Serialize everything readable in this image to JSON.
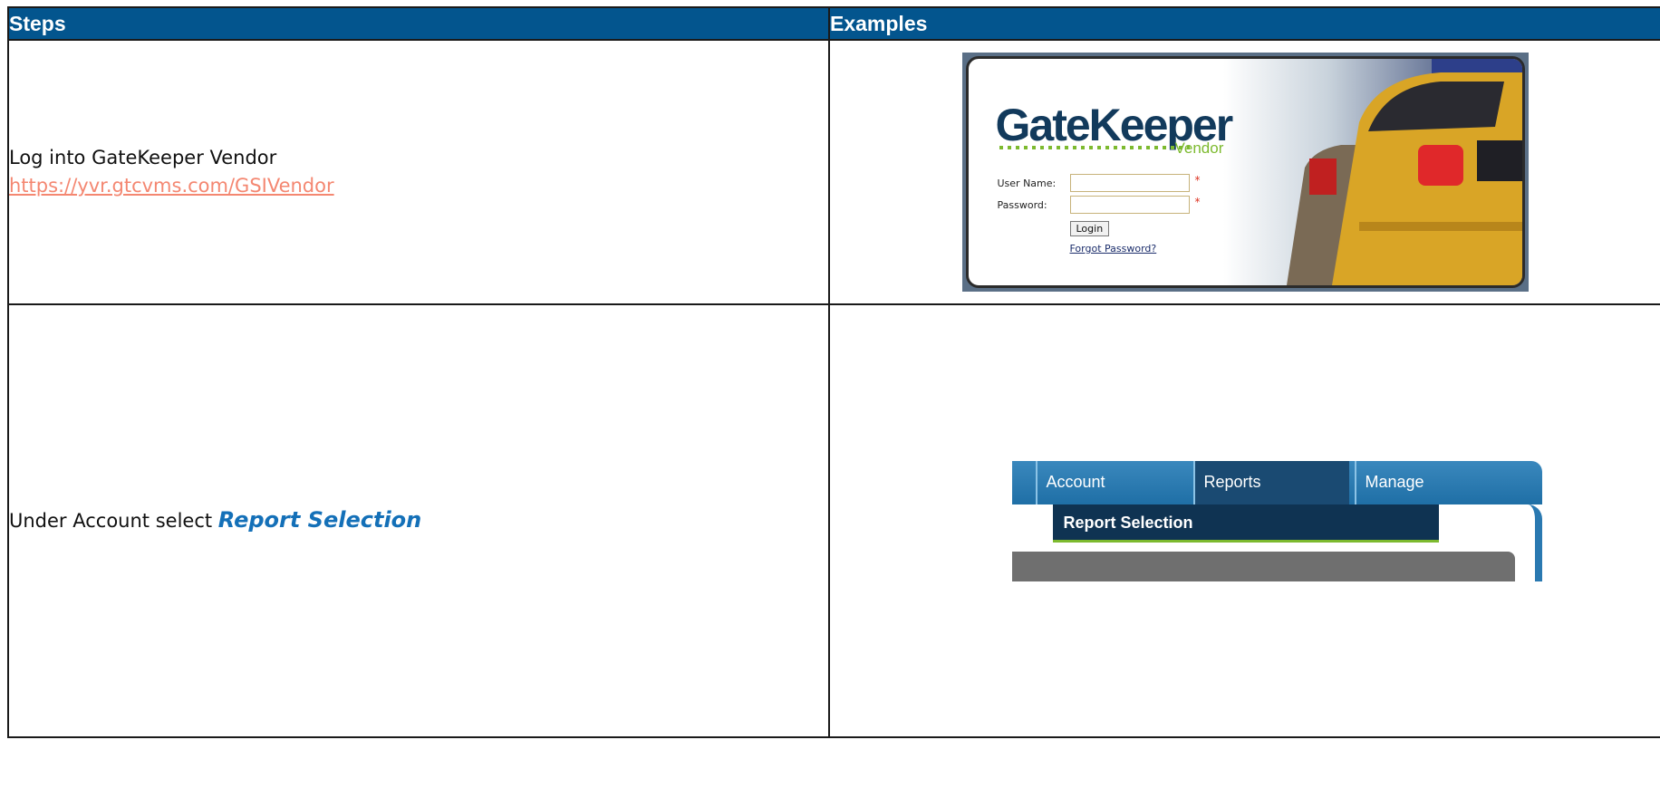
{
  "table": {
    "headers": {
      "steps": "Steps",
      "examples": "Examples"
    },
    "rows": [
      {
        "step_text": "Log into GateKeeper Vendor",
        "step_link": "https://yvr.gtcvms.com/GSIVendor",
        "example": {
          "logo_text": "GateKeeper",
          "logo_sub": "Vendor",
          "username_label": "User Name:",
          "password_label": "Password:",
          "required_mark": "*",
          "login_button": "Login",
          "forgot_link": "Forgot Password?"
        }
      },
      {
        "step_text": "Under Account select ",
        "step_emphasis": "Report Selection",
        "example": {
          "menu_items": [
            "Account",
            "Reports",
            "Manage"
          ],
          "dropdown_item": "Report Selection"
        }
      }
    ]
  },
  "colors": {
    "header_bg": "#03558e",
    "link": "#f48771",
    "emphasis": "#1470b8",
    "accent_green": "#7dba2f"
  }
}
